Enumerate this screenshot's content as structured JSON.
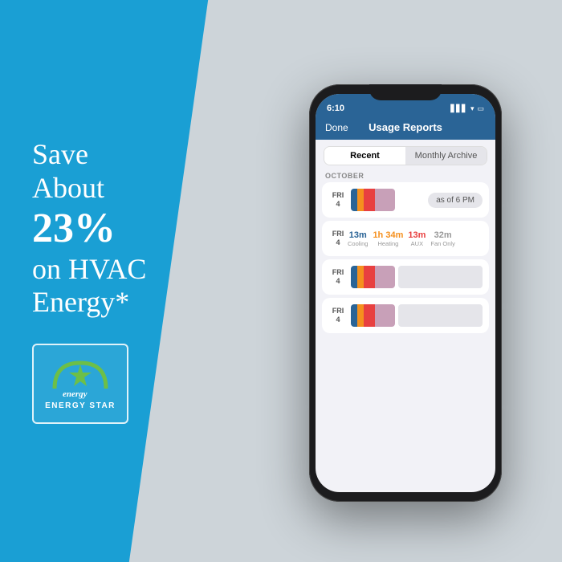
{
  "left": {
    "tagline_line1": "Save",
    "tagline_line2": "About",
    "tagline_percent": "23%",
    "tagline_line3": "on HVAC",
    "tagline_line4": "Energy*",
    "energy_star_label": "ENERGY STAR"
  },
  "phone": {
    "status_time": "6:10",
    "status_icons": "▲ ▼ ●",
    "nav_done": "Done",
    "nav_title": "Usage Reports",
    "segment_recent": "Recent",
    "segment_archive": "Monthly Archive",
    "section_month": "OCTOBER",
    "row1": {
      "day": "FRI",
      "date": "4",
      "as_of": "as of 6 PM"
    },
    "row2": {
      "day": "FRI",
      "date": "4",
      "stat1_val": "13m",
      "stat1_label": "Cooling",
      "stat2_val": "1h 34m",
      "stat2_label": "Heating",
      "stat3_val": "13m",
      "stat3_label": "AUX",
      "stat4_val": "32m",
      "stat4_label": "Fan Only"
    },
    "row3": {
      "day": "FRI",
      "date": "4"
    },
    "row4": {
      "day": "FRI",
      "date": "4"
    }
  }
}
